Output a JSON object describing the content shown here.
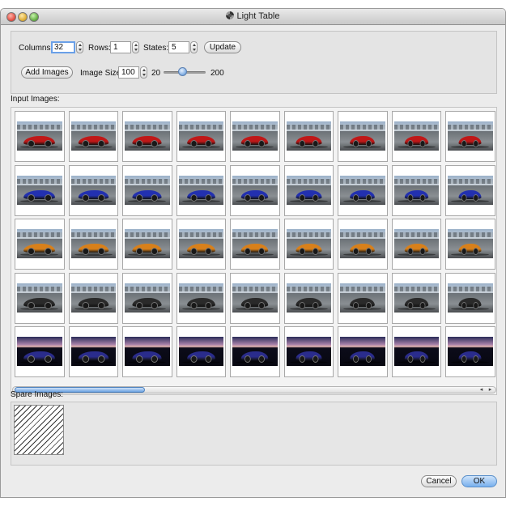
{
  "window": {
    "title": "Light Table"
  },
  "controls": {
    "columns_label": "Columns:",
    "columns_value": "32",
    "rows_label": "Rows:",
    "rows_value": "1",
    "states_label": "States:",
    "states_value": "5",
    "update_label": "Update",
    "add_images_label": "Add Images",
    "image_size_label": "Image Size:",
    "image_size_value": "100",
    "slider_min_label": "20",
    "slider_max_label": "200",
    "slider_value": 100
  },
  "input_images": {
    "label": "Input Images:",
    "visible_columns": 9,
    "rows": [
      {
        "car_color": "#c01818",
        "scene": "day"
      },
      {
        "car_color": "#2230b0",
        "scene": "day"
      },
      {
        "car_color": "#d8801a",
        "scene": "day"
      },
      {
        "car_color": "#2a2a2a",
        "scene": "day"
      },
      {
        "car_color": "#2a2c8c",
        "scene": "sunset"
      }
    ],
    "scroll_fraction": 0.28
  },
  "spare_images": {
    "label": "Spare Images:"
  },
  "footer": {
    "cancel_label": "Cancel",
    "ok_label": "OK"
  },
  "colors": {
    "accent": "#6da3e2",
    "window_bg": "#ececec"
  }
}
